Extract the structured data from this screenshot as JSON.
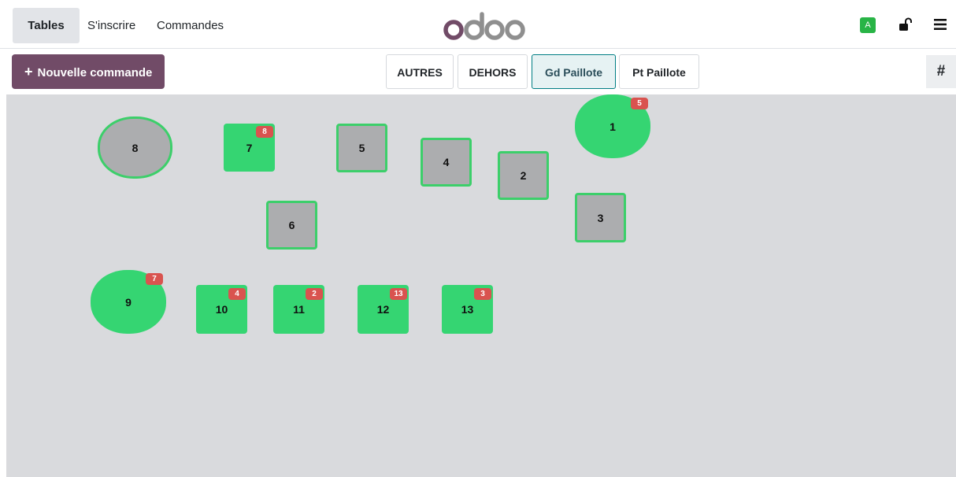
{
  "navbar": {
    "tabs": [
      {
        "label": "Tables",
        "active": true
      },
      {
        "label": "S'inscrire",
        "active": false
      },
      {
        "label": "Commandes",
        "active": false
      }
    ],
    "logo": "odoo",
    "user_badge": "A",
    "icons": {
      "lock": "unlock-icon",
      "menu": "hamburger-icon"
    }
  },
  "toolbar": {
    "new_order_label": "Nouvelle commande",
    "floors": [
      "AUTRES",
      "DEHORS",
      "Gd Paillote",
      "Pt Paillote"
    ],
    "selected_floor": "Gd Paillote",
    "hash_label": "#"
  },
  "colors": {
    "brand": "#714b67",
    "occupied": "#35d572",
    "free": "#acadaf",
    "badge": "#d9534f",
    "floor_bg": "#d9dadd"
  },
  "tables": [
    {
      "name": "8",
      "state": "free",
      "shape": "round",
      "orders": ""
    },
    {
      "name": "7",
      "state": "busy",
      "shape": "square",
      "orders": "8"
    },
    {
      "name": "5",
      "state": "free",
      "shape": "square",
      "orders": ""
    },
    {
      "name": "4",
      "state": "free",
      "shape": "square",
      "orders": ""
    },
    {
      "name": "2",
      "state": "free",
      "shape": "square",
      "orders": ""
    },
    {
      "name": "1",
      "state": "busy",
      "shape": "round",
      "orders": "5"
    },
    {
      "name": "6",
      "state": "free",
      "shape": "square",
      "orders": ""
    },
    {
      "name": "3",
      "state": "free",
      "shape": "square",
      "orders": ""
    },
    {
      "name": "9",
      "state": "busy",
      "shape": "round",
      "orders": "7"
    },
    {
      "name": "10",
      "state": "busy",
      "shape": "square",
      "orders": "4"
    },
    {
      "name": "11",
      "state": "busy",
      "shape": "square",
      "orders": "2"
    },
    {
      "name": "12",
      "state": "busy",
      "shape": "square",
      "orders": "13"
    },
    {
      "name": "13",
      "state": "busy",
      "shape": "square",
      "orders": "3"
    }
  ]
}
